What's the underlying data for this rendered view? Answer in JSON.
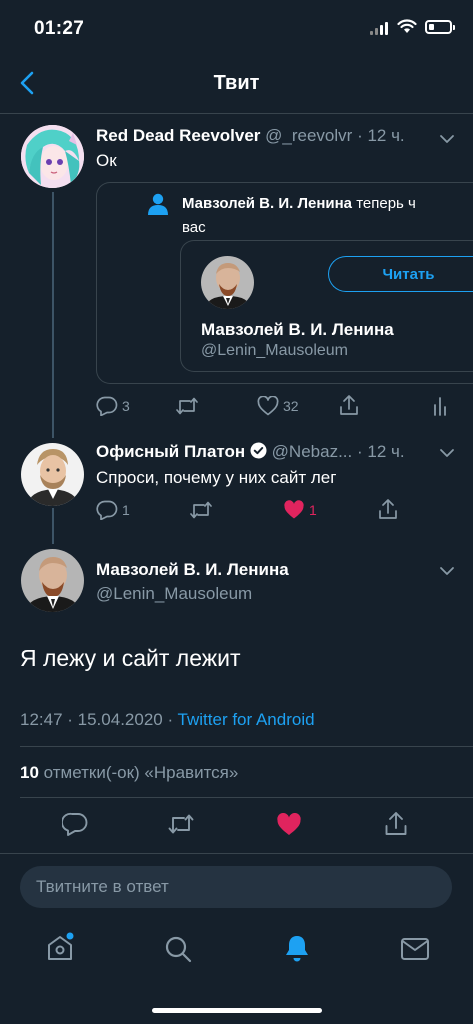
{
  "status_bar": {
    "time": "01:27"
  },
  "header": {
    "title": "Твит"
  },
  "tweets": [
    {
      "name": "Red Dead Reevolver",
      "handle": "@_reevolvr",
      "time": "· 12 ч.",
      "text": "Ок",
      "quote": {
        "notice_name": "Мавзолей В. И. Ленина",
        "notice_rest": "теперь ч",
        "notice_line2": "вас",
        "account_name": "Мавзолей В. И. Ленина",
        "account_handle": "@Lenin_Mausoleum",
        "follow_label": "Читать"
      },
      "replies": "3",
      "likes": "32"
    },
    {
      "name": "Офисный Платон",
      "handle": "@Nebaz...",
      "time": "· 12 ч.",
      "text": "Спроси, почему у них сайт лег",
      "replies": "1",
      "likes": "1"
    }
  ],
  "main_tweet": {
    "name": "Мавзолей В. И. Ленина",
    "handle": "@Lenin_Mausoleum",
    "text": "Я лежу и сайт лежит",
    "timestamp": "12:47 · 15.04.2020 ·",
    "source": "Twitter for Android",
    "likes_count": "10",
    "likes_label": "отметки(-ок) «Нравится»"
  },
  "reply": {
    "placeholder": "Твитните в ответ"
  },
  "colors": {
    "background": "#15202b",
    "accent": "#1da1f2",
    "like": "#e0245e",
    "muted": "#8899a6",
    "border": "#38444d"
  },
  "icons": [
    "back-arrow-icon",
    "person-icon",
    "reply-icon",
    "retweet-icon",
    "like-icon",
    "share-icon",
    "analytics-icon",
    "verified-icon",
    "chevron-down-icon",
    "home-icon",
    "search-icon",
    "bell-icon",
    "mail-icon"
  ]
}
